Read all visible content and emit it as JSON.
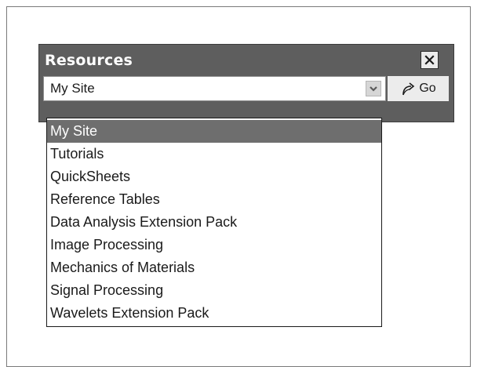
{
  "panel": {
    "title": "Resources",
    "close_icon": "close-icon"
  },
  "site_select": {
    "value": "My Site",
    "arrow_icon": "chevron-down-icon"
  },
  "go_button": {
    "label": "Go",
    "icon": "redo-arrow-icon"
  },
  "dropdown": {
    "items": [
      "My Site",
      "Tutorials",
      "QuickSheets",
      "Reference Tables",
      "Data Analysis Extension Pack",
      "Image Processing",
      "Mechanics of Materials",
      "Signal Processing",
      "Wavelets Extension Pack"
    ],
    "selected": "My Site"
  },
  "colors": {
    "toolbar_bg": "#5e5e5e",
    "selected_bg": "#6e6e6e"
  }
}
